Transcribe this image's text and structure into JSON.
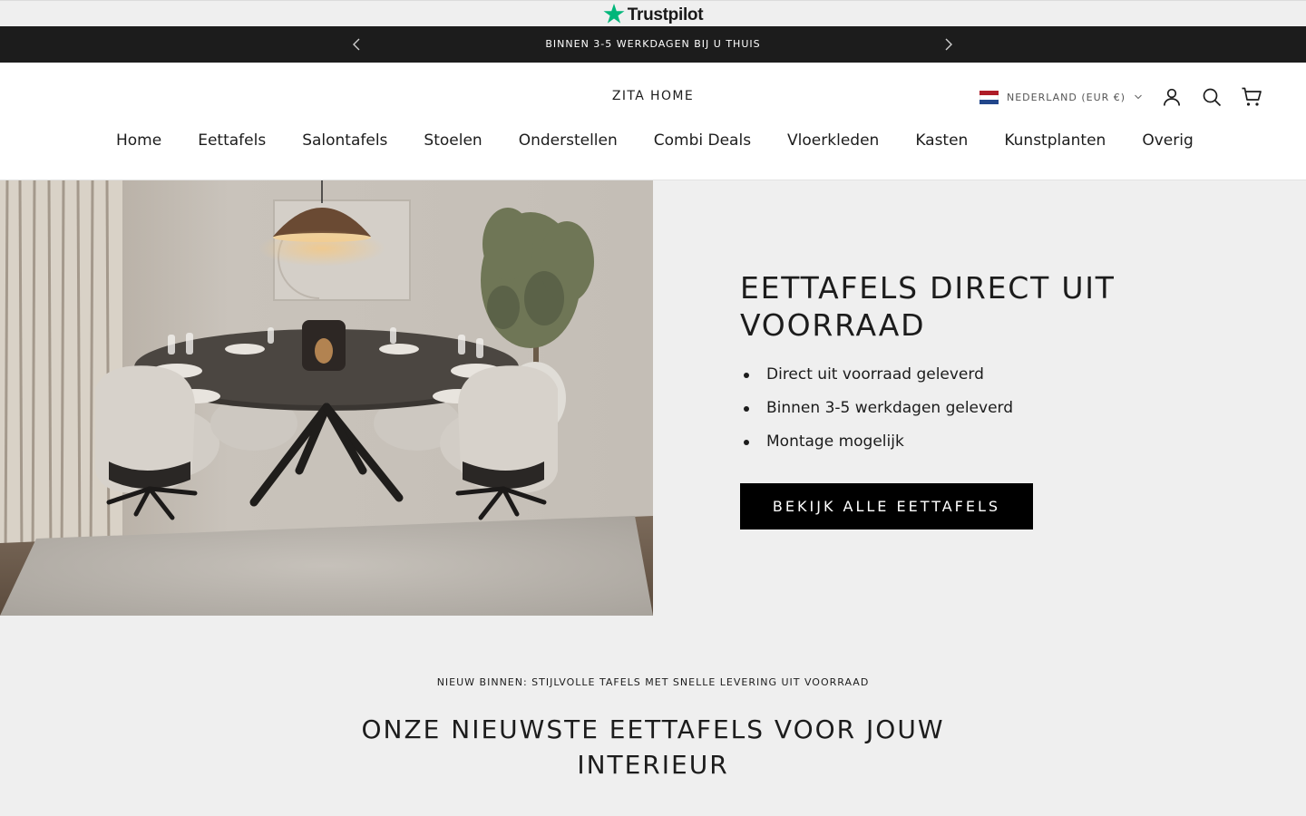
{
  "trustpilot": {
    "label": "Trustpilot",
    "star_color": "#00b67a"
  },
  "announcement": {
    "text": "BINNEN 3-5 WERKDAGEN BIJ U THUIS",
    "prev_icon": "chevron-left-icon",
    "next_icon": "chevron-right-icon"
  },
  "header": {
    "logo": "ZITA HOME",
    "country": {
      "label": "NEDERLAND (EUR €)",
      "flag": [
        "#ae1c28",
        "#ffffff",
        "#21468b"
      ]
    },
    "icons": [
      "account-icon",
      "search-icon",
      "cart-icon"
    ]
  },
  "nav": {
    "items": [
      "Home",
      "Eettafels",
      "Salontafels",
      "Stoelen",
      "Onderstellen",
      "Combi Deals",
      "Vloerkleden",
      "Kasten",
      "Kunstplanten",
      "Overig"
    ]
  },
  "hero": {
    "title": "EETTAFELS DIRECT UIT VOORRAAD",
    "bullets": [
      "Direct uit voorraad geleverd",
      "Binnen 3-5 werkdagen geleverd",
      "Montage mogelijk"
    ],
    "button": "BEKIJK ALLE EETTAFELS"
  },
  "section": {
    "subtitle": "NIEUW BINNEN: STIJLVOLLE TAFELS MET SNELLE LEVERING UIT VOORRAAD",
    "title": "ONZE NIEUWSTE EETTAFELS VOOR JOUW INTERIEUR"
  },
  "colors": {
    "announcement_bg": "#1c1c1c",
    "page_bg": "#efefef",
    "button_bg": "#000000"
  }
}
